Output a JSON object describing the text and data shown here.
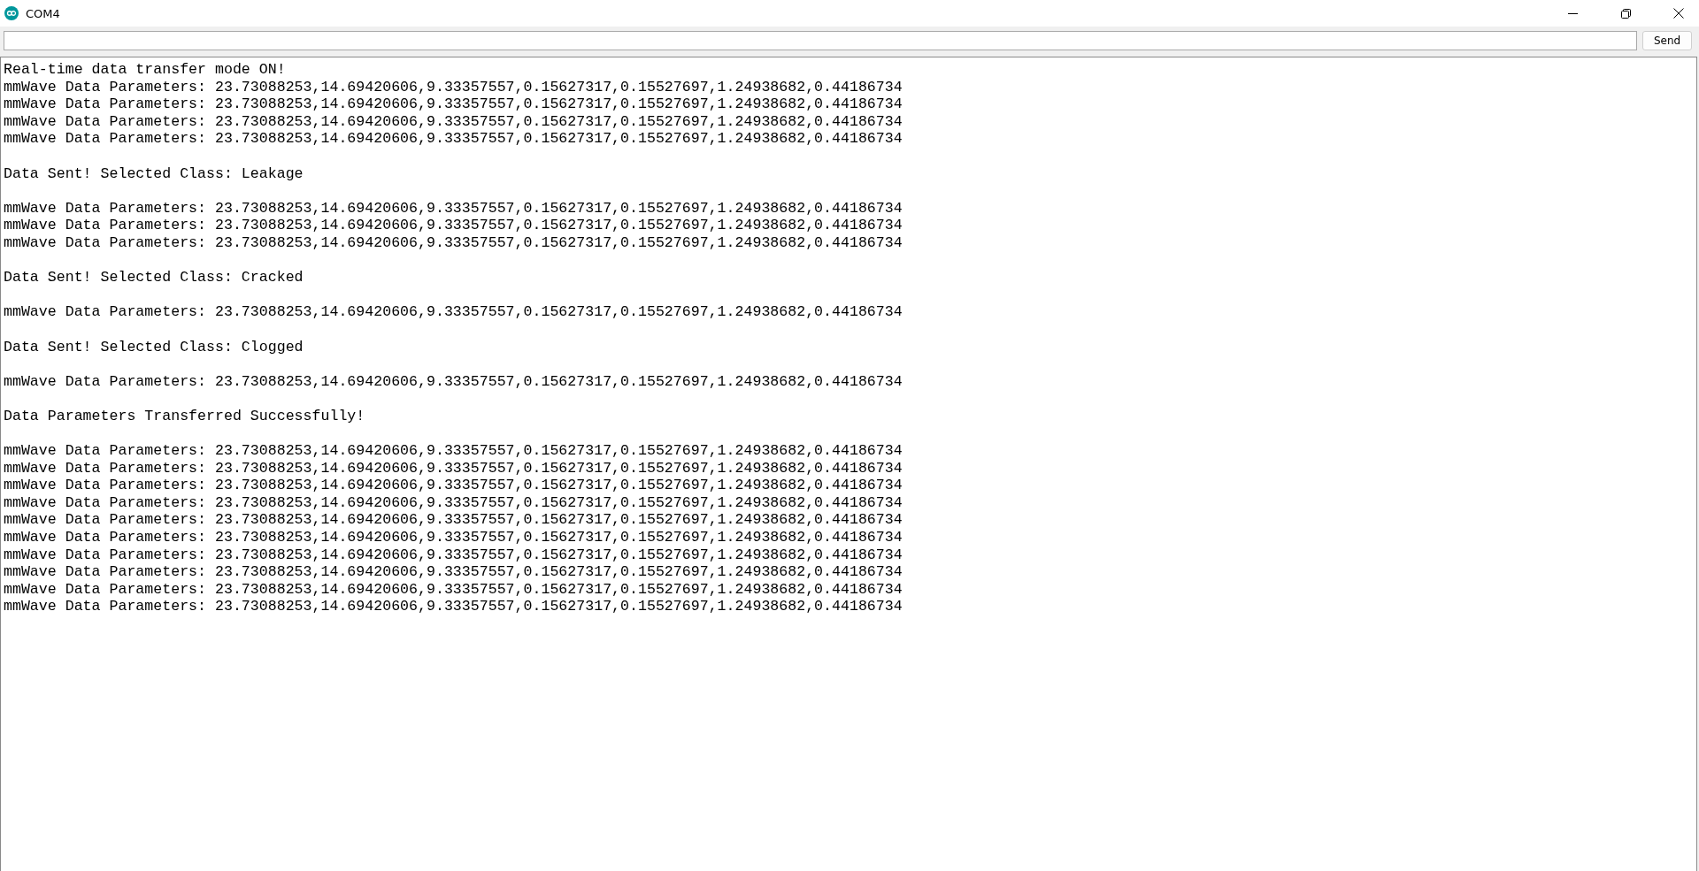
{
  "window": {
    "title": "COM4"
  },
  "input": {
    "send_label": "Send"
  },
  "output": [
    {
      "kind": "line",
      "text": "Real-time data transfer mode ON!"
    },
    {
      "kind": "line",
      "text": "mmWave Data Parameters: 23.73088253,14.69420606,9.33357557,0.15627317,0.15527697,1.24938682,0.44186734"
    },
    {
      "kind": "line",
      "text": "mmWave Data Parameters: 23.73088253,14.69420606,9.33357557,0.15627317,0.15527697,1.24938682,0.44186734"
    },
    {
      "kind": "line",
      "text": "mmWave Data Parameters: 23.73088253,14.69420606,9.33357557,0.15627317,0.15527697,1.24938682,0.44186734"
    },
    {
      "kind": "line",
      "text": "mmWave Data Parameters: 23.73088253,14.69420606,9.33357557,0.15627317,0.15527697,1.24938682,0.44186734"
    },
    {
      "kind": "blank"
    },
    {
      "kind": "line",
      "text": "Data Sent! Selected Class: Leakage"
    },
    {
      "kind": "blank"
    },
    {
      "kind": "line",
      "text": "mmWave Data Parameters: 23.73088253,14.69420606,9.33357557,0.15627317,0.15527697,1.24938682,0.44186734"
    },
    {
      "kind": "line",
      "text": "mmWave Data Parameters: 23.73088253,14.69420606,9.33357557,0.15627317,0.15527697,1.24938682,0.44186734"
    },
    {
      "kind": "line",
      "text": "mmWave Data Parameters: 23.73088253,14.69420606,9.33357557,0.15627317,0.15527697,1.24938682,0.44186734"
    },
    {
      "kind": "blank"
    },
    {
      "kind": "line",
      "text": "Data Sent! Selected Class: Cracked"
    },
    {
      "kind": "blank"
    },
    {
      "kind": "line",
      "text": "mmWave Data Parameters: 23.73088253,14.69420606,9.33357557,0.15627317,0.15527697,1.24938682,0.44186734"
    },
    {
      "kind": "blank"
    },
    {
      "kind": "line",
      "text": "Data Sent! Selected Class: Clogged"
    },
    {
      "kind": "blank"
    },
    {
      "kind": "line",
      "text": "mmWave Data Parameters: 23.73088253,14.69420606,9.33357557,0.15627317,0.15527697,1.24938682,0.44186734"
    },
    {
      "kind": "blank"
    },
    {
      "kind": "line",
      "text": "Data Parameters Transferred Successfully!"
    },
    {
      "kind": "blank"
    },
    {
      "kind": "line",
      "text": "mmWave Data Parameters: 23.73088253,14.69420606,9.33357557,0.15627317,0.15527697,1.24938682,0.44186734"
    },
    {
      "kind": "line",
      "text": "mmWave Data Parameters: 23.73088253,14.69420606,9.33357557,0.15627317,0.15527697,1.24938682,0.44186734"
    },
    {
      "kind": "line",
      "text": "mmWave Data Parameters: 23.73088253,14.69420606,9.33357557,0.15627317,0.15527697,1.24938682,0.44186734"
    },
    {
      "kind": "line",
      "text": "mmWave Data Parameters: 23.73088253,14.69420606,9.33357557,0.15627317,0.15527697,1.24938682,0.44186734"
    },
    {
      "kind": "line",
      "text": "mmWave Data Parameters: 23.73088253,14.69420606,9.33357557,0.15627317,0.15527697,1.24938682,0.44186734"
    },
    {
      "kind": "line",
      "text": "mmWave Data Parameters: 23.73088253,14.69420606,9.33357557,0.15627317,0.15527697,1.24938682,0.44186734"
    },
    {
      "kind": "line",
      "text": "mmWave Data Parameters: 23.73088253,14.69420606,9.33357557,0.15627317,0.15527697,1.24938682,0.44186734"
    },
    {
      "kind": "line",
      "text": "mmWave Data Parameters: 23.73088253,14.69420606,9.33357557,0.15627317,0.15527697,1.24938682,0.44186734"
    },
    {
      "kind": "line",
      "text": "mmWave Data Parameters: 23.73088253,14.69420606,9.33357557,0.15627317,0.15527697,1.24938682,0.44186734"
    },
    {
      "kind": "line",
      "text": "mmWave Data Parameters: 23.73088253,14.69420606,9.33357557,0.15627317,0.15527697,1.24938682,0.44186734"
    }
  ]
}
